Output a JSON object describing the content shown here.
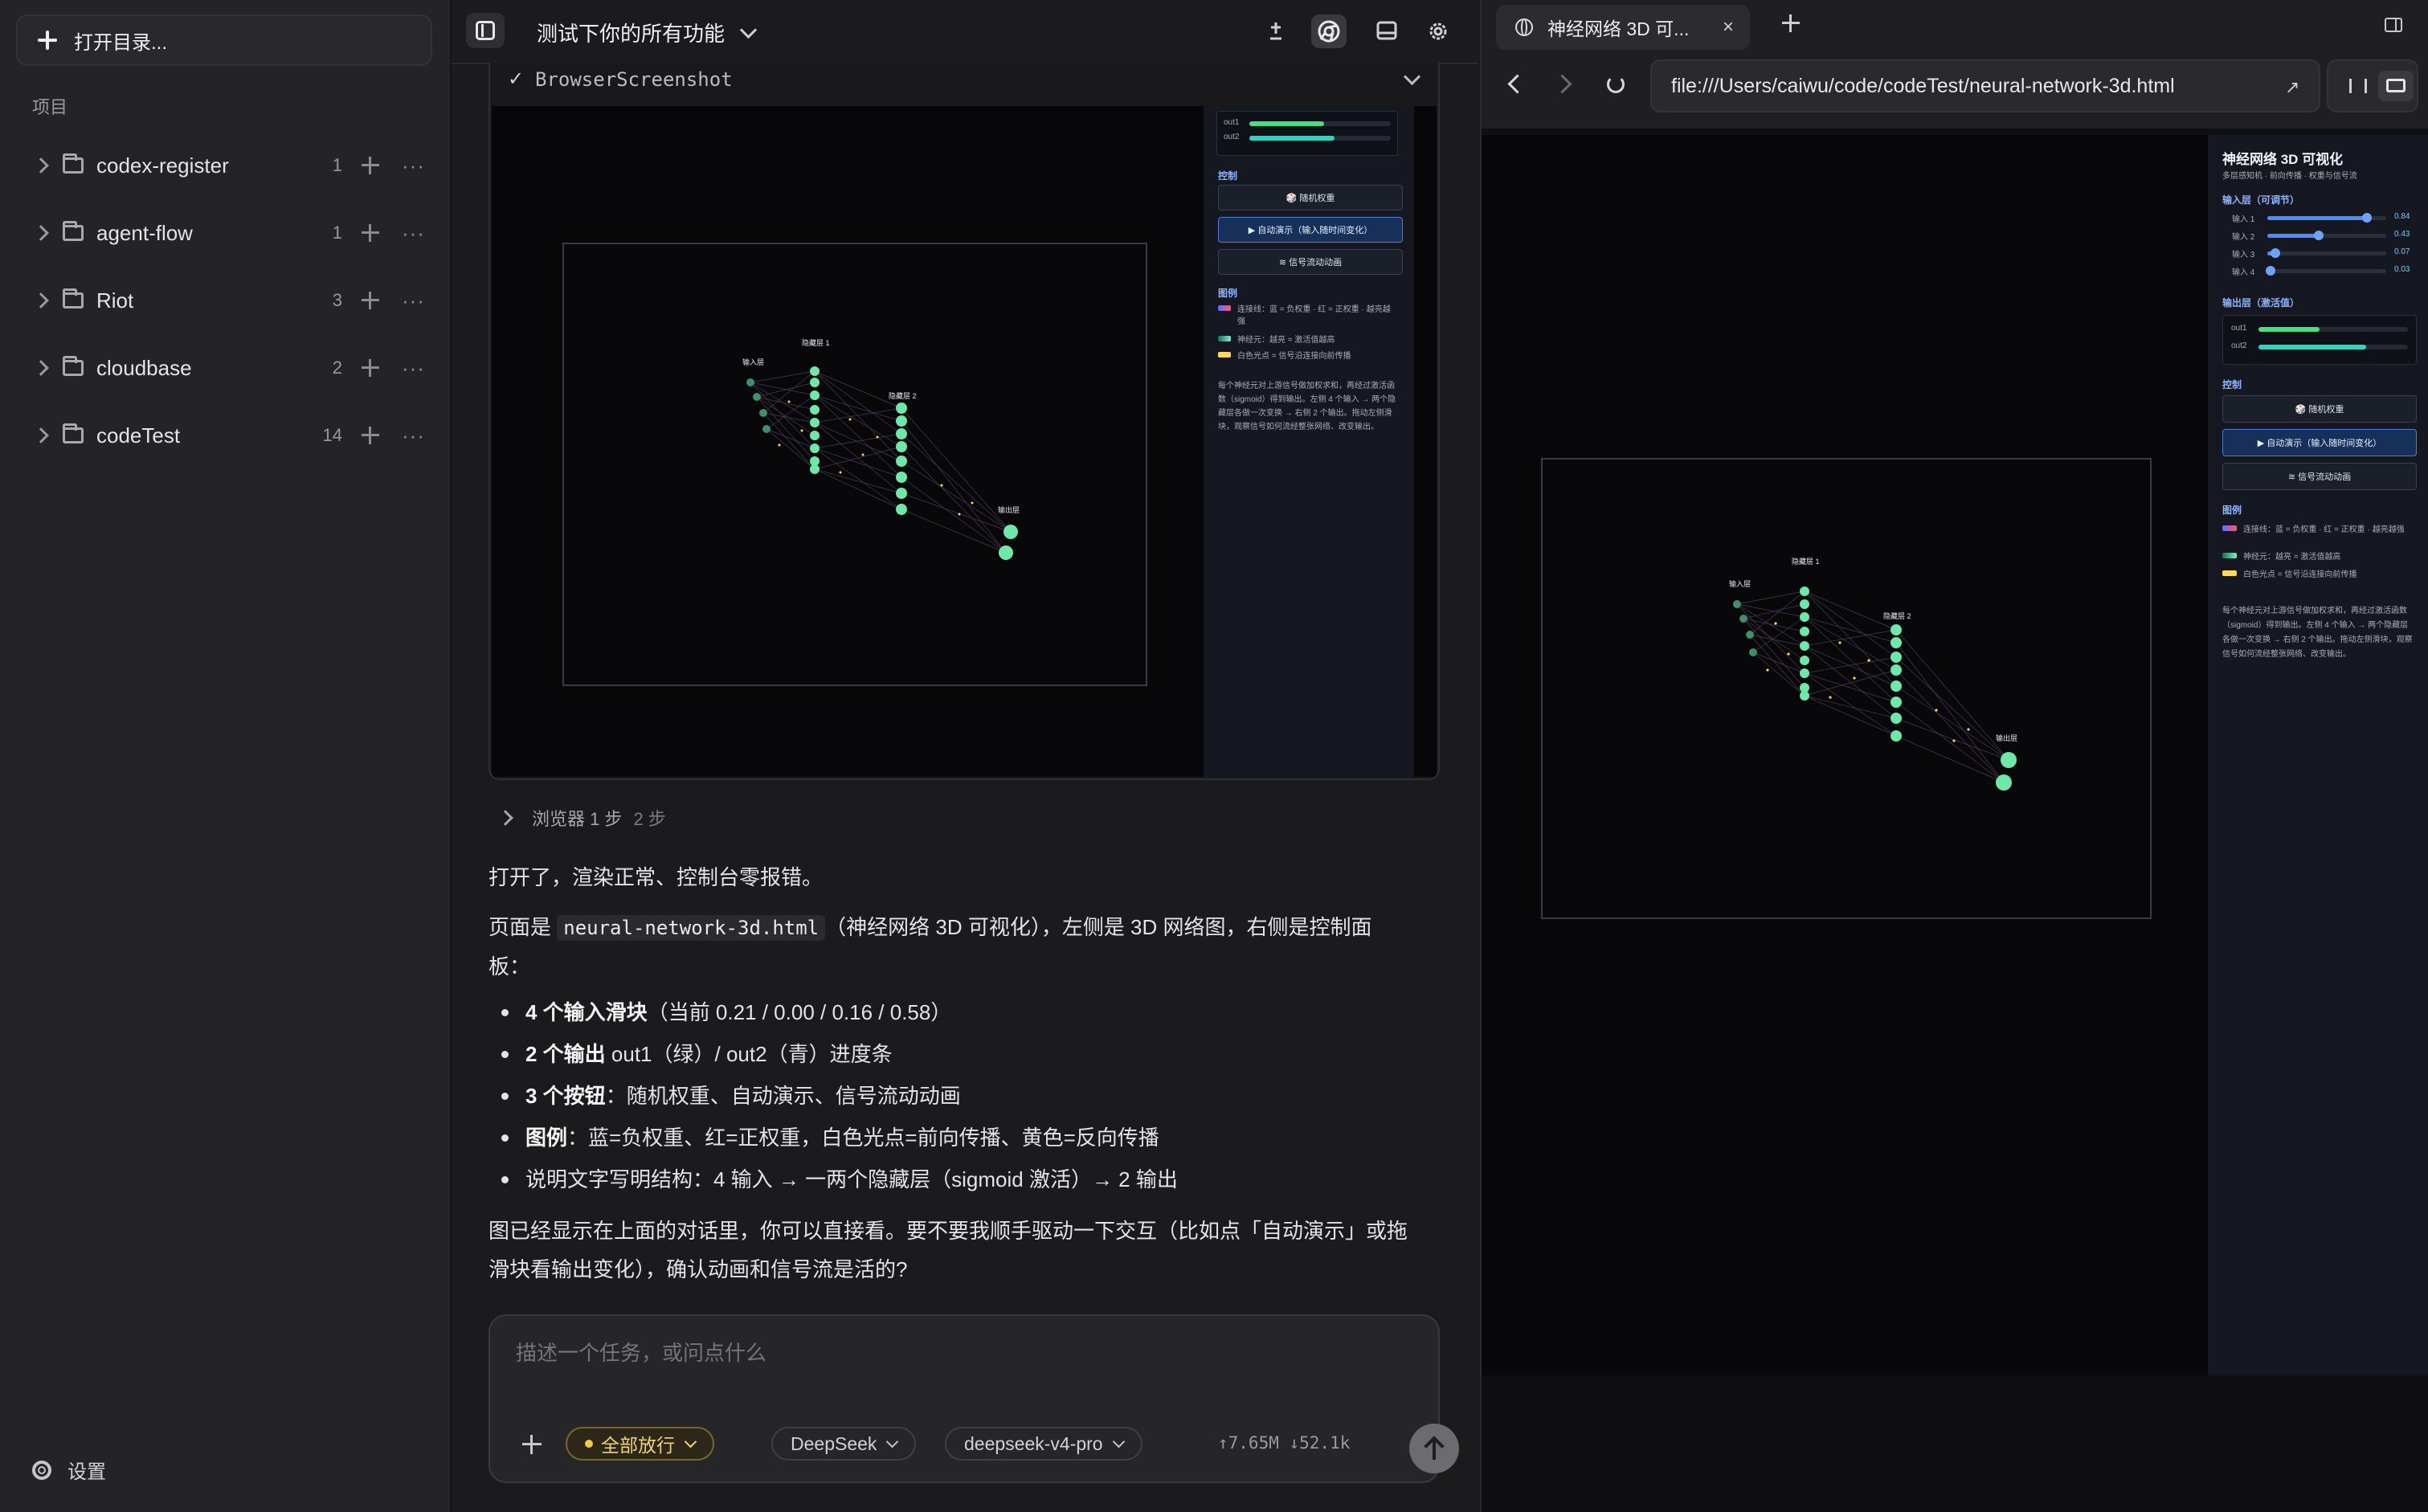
{
  "sidebar": {
    "open_dir_label": "打开目录...",
    "projects_heading": "项目",
    "projects": [
      {
        "name": "codex-register",
        "count": "1"
      },
      {
        "name": "agent-flow",
        "count": "1"
      },
      {
        "name": "Riot",
        "count": "3"
      },
      {
        "name": "cloudbase",
        "count": "2"
      },
      {
        "name": "codeTest",
        "count": "14"
      }
    ],
    "settings_label": "设置"
  },
  "center": {
    "thread_title": "测试下你的所有功能",
    "tool_card": {
      "status_icon": "✓",
      "name": "BrowserScreenshot"
    },
    "steps": {
      "label": "浏览器 1 步",
      "sub": "2 步"
    },
    "message": {
      "p1": "打开了，渲染正常、控制台零报错。",
      "p2_prefix": "页面是",
      "p2_code": "neural-network-3d.html",
      "p2_suffix_line1": "（神经网络 3D 可视化），左侧是 3D 网络图，右侧是控制面",
      "p2_suffix_line2": "板：",
      "bullets": [
        {
          "bold": "4 个输入滑块",
          "rest": "（当前 0.21 / 0.00 / 0.16 / 0.58）"
        },
        {
          "bold": "2 个输出",
          "rest": " out1（绿）/ out2（青）进度条"
        },
        {
          "bold": "3 个按钮",
          "rest": "：随机权重、自动演示、信号流动动画"
        },
        {
          "bold": "图例",
          "rest": "：蓝=负权重、红=正权重，白色光点=前向传播、黄色=反向传播"
        },
        {
          "bold": "",
          "rest": "说明文字写明结构：4 输入 → 一两个隐藏层（sigmoid 激活）→ 2 输出"
        }
      ],
      "p3_line1": "图已经显示在上面的对话里，你可以直接看。要不要我顺手驱动一下交互（比如点「自动演示」或拖",
      "p3_line2": "滑块看输出变化），确认动画和信号流是活的?"
    },
    "composer": {
      "placeholder": "描述一个任务，或问点什么",
      "permission": "全部放行",
      "provider": "DeepSeek",
      "model": "deepseek-v4-pro",
      "tokens": "↑7.65M ↓52.1k"
    }
  },
  "mini_page": {
    "title": "神经网络 3D 可视化",
    "subtitle": "多层感知机 · 前向传播 · 权重与信号流",
    "inputs_heading": "输入层（可调节）",
    "inputs": [
      {
        "label": "输入 1",
        "value": 0.84,
        "value_text": "0.84"
      },
      {
        "label": "输入 2",
        "value": 0.43,
        "value_text": "0.43"
      },
      {
        "label": "输入 3",
        "value": 0.07,
        "value_text": "0.07"
      },
      {
        "label": "输入 4",
        "value": 0.03,
        "value_text": "0.03"
      }
    ],
    "outputs_heading": "输出层（激活值）",
    "outputs": [
      {
        "label": "out1",
        "value": 0.41,
        "color": "#4ade80"
      },
      {
        "label": "out2",
        "value": 0.72,
        "color": "#2dd4bf"
      }
    ],
    "outputs_card": [
      {
        "label": "out1",
        "value": 0.53,
        "color": "#4ade80"
      },
      {
        "label": "out2",
        "value": 0.6,
        "color": "#2dd4bf"
      }
    ],
    "controls_heading": "控制",
    "buttons": [
      "🎲 随机权重",
      "▶ 自动演示（输入随时间变化）",
      "≋ 信号流动动画"
    ],
    "legend_heading": "图例",
    "legend": [
      {
        "text": "连接线：蓝 = 负权重 · 红 = 正权重 · 越亮越强",
        "colors": [
          "#5b6cff",
          "#ff5b6c"
        ]
      },
      {
        "text": "神经元：越亮 = 激活值越高",
        "colors": [
          "#1f6b5a",
          "#7cf2c8"
        ]
      },
      {
        "text": "白色光点 = 信号沿连接向前传播",
        "colors": [
          "#ffd75a",
          "#ffd75a"
        ]
      }
    ],
    "description": "每个神经元对上游信号做加权求和，再经过激活函数（sigmoid）得到输出。左侧 4 个输入 → 两个隐藏层各做一次变换 → 右侧 2 个输出。拖动左侧滑块，观察信号如何流经整张网络、改变输出。",
    "layer_labels": [
      "输入层",
      "隐藏层 1",
      "隐藏层 2",
      "输出层"
    ]
  },
  "browser": {
    "tab_title": "神经网络 3D 可...",
    "tab_close": "×",
    "url": "file:///Users/caiwu/code/codeTest/neural-network-3d.html",
    "url_open_icon": "↗"
  },
  "colors": {
    "accent_green": "#4ade80",
    "accent_teal": "#2dd4bf",
    "link_blue": "#8fb4ff",
    "permission_yellow": "#f3c846"
  }
}
